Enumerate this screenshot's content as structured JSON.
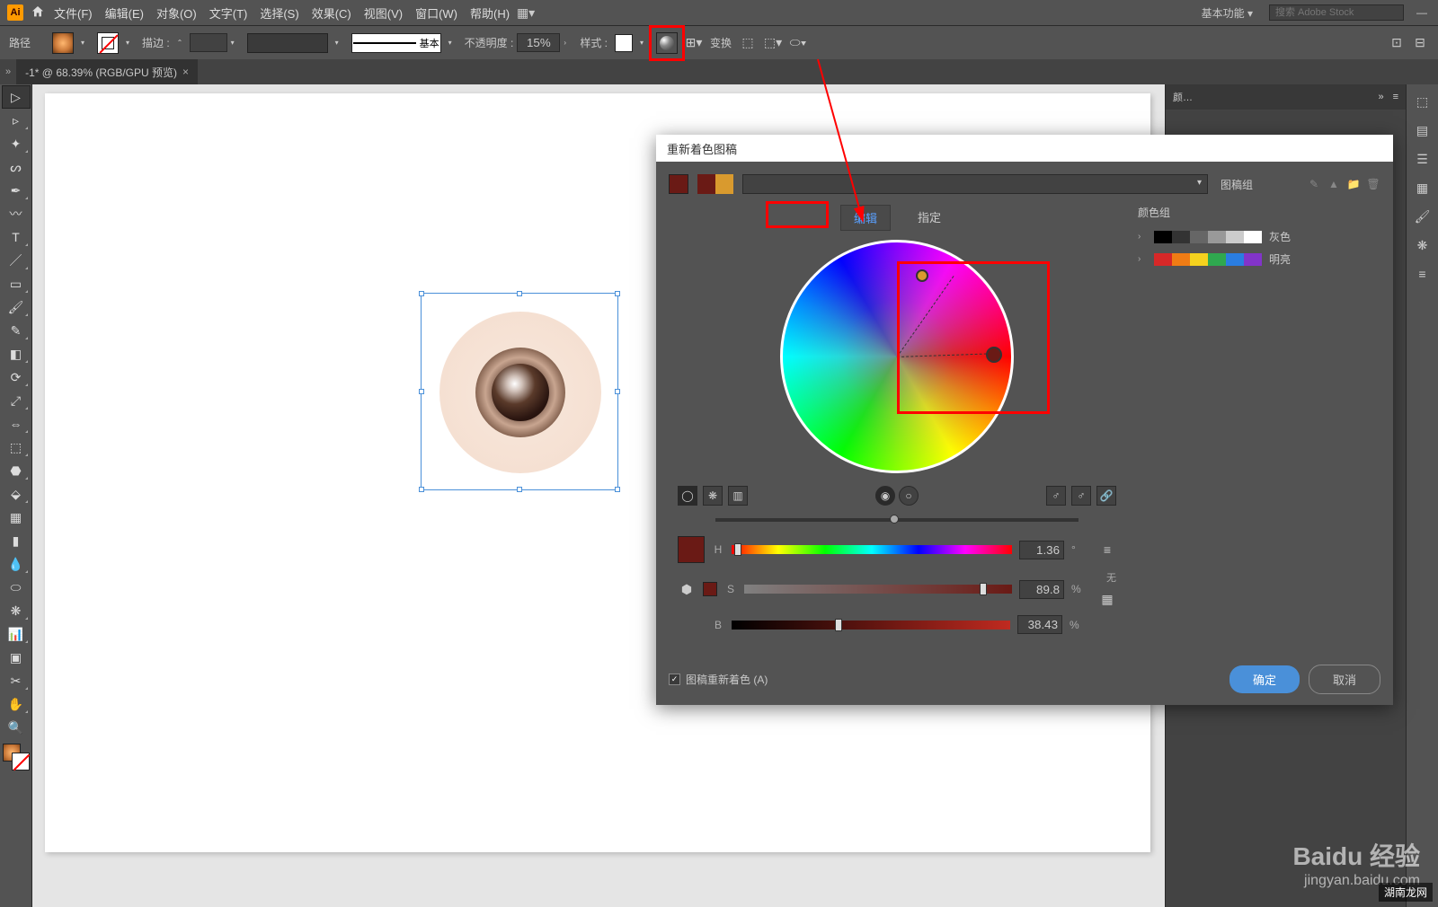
{
  "menubar": {
    "app_abbr": "Ai",
    "items": [
      "文件(F)",
      "编辑(E)",
      "对象(O)",
      "文字(T)",
      "选择(S)",
      "效果(C)",
      "视图(V)",
      "窗口(W)",
      "帮助(H)"
    ],
    "workspace": "基本功能",
    "search_placeholder": "搜索 Adobe Stock"
  },
  "optbar": {
    "label": "路径",
    "stroke_label": "描边 :",
    "stroke_weight": "",
    "brush_label": "基本",
    "opacity_label": "不透明度 :",
    "opacity_value": "15%",
    "style_label": "样式 :",
    "transform_label": "变换"
  },
  "tab": {
    "name": "-1* @ 68.39% (RGB/GPU 预览)"
  },
  "panels": {
    "color_tab": "颜…"
  },
  "dialog": {
    "title": "重新着色图稿",
    "tabs": {
      "edit": "编辑",
      "assign": "指定"
    },
    "color_groups_label": "颜色组",
    "groups": [
      {
        "name": "灰色",
        "colors": [
          "#000000",
          "#333333",
          "#666666",
          "#999999",
          "#cccccc",
          "#ffffff"
        ]
      },
      {
        "name": "明亮",
        "colors": [
          "#d72828",
          "#f07c14",
          "#f5d21e",
          "#2fa84f",
          "#2a7de1",
          "#8234c9"
        ]
      }
    ],
    "group_name_placeholder": "图稿组",
    "hsb": {
      "h_label": "H",
      "h_value": "1.36",
      "h_unit": "°",
      "s_label": "S",
      "s_value": "89.8",
      "s_unit": "%",
      "b_label": "B",
      "b_value": "38.43",
      "b_unit": "%"
    },
    "none_label": "无",
    "recolor_check": "图稿重新着色 (A)",
    "ok": "确定",
    "cancel": "取消"
  },
  "watermark": {
    "main": "Baidu 经验",
    "sub": "jingyan.baidu.com",
    "corner": "湖南龙网"
  }
}
